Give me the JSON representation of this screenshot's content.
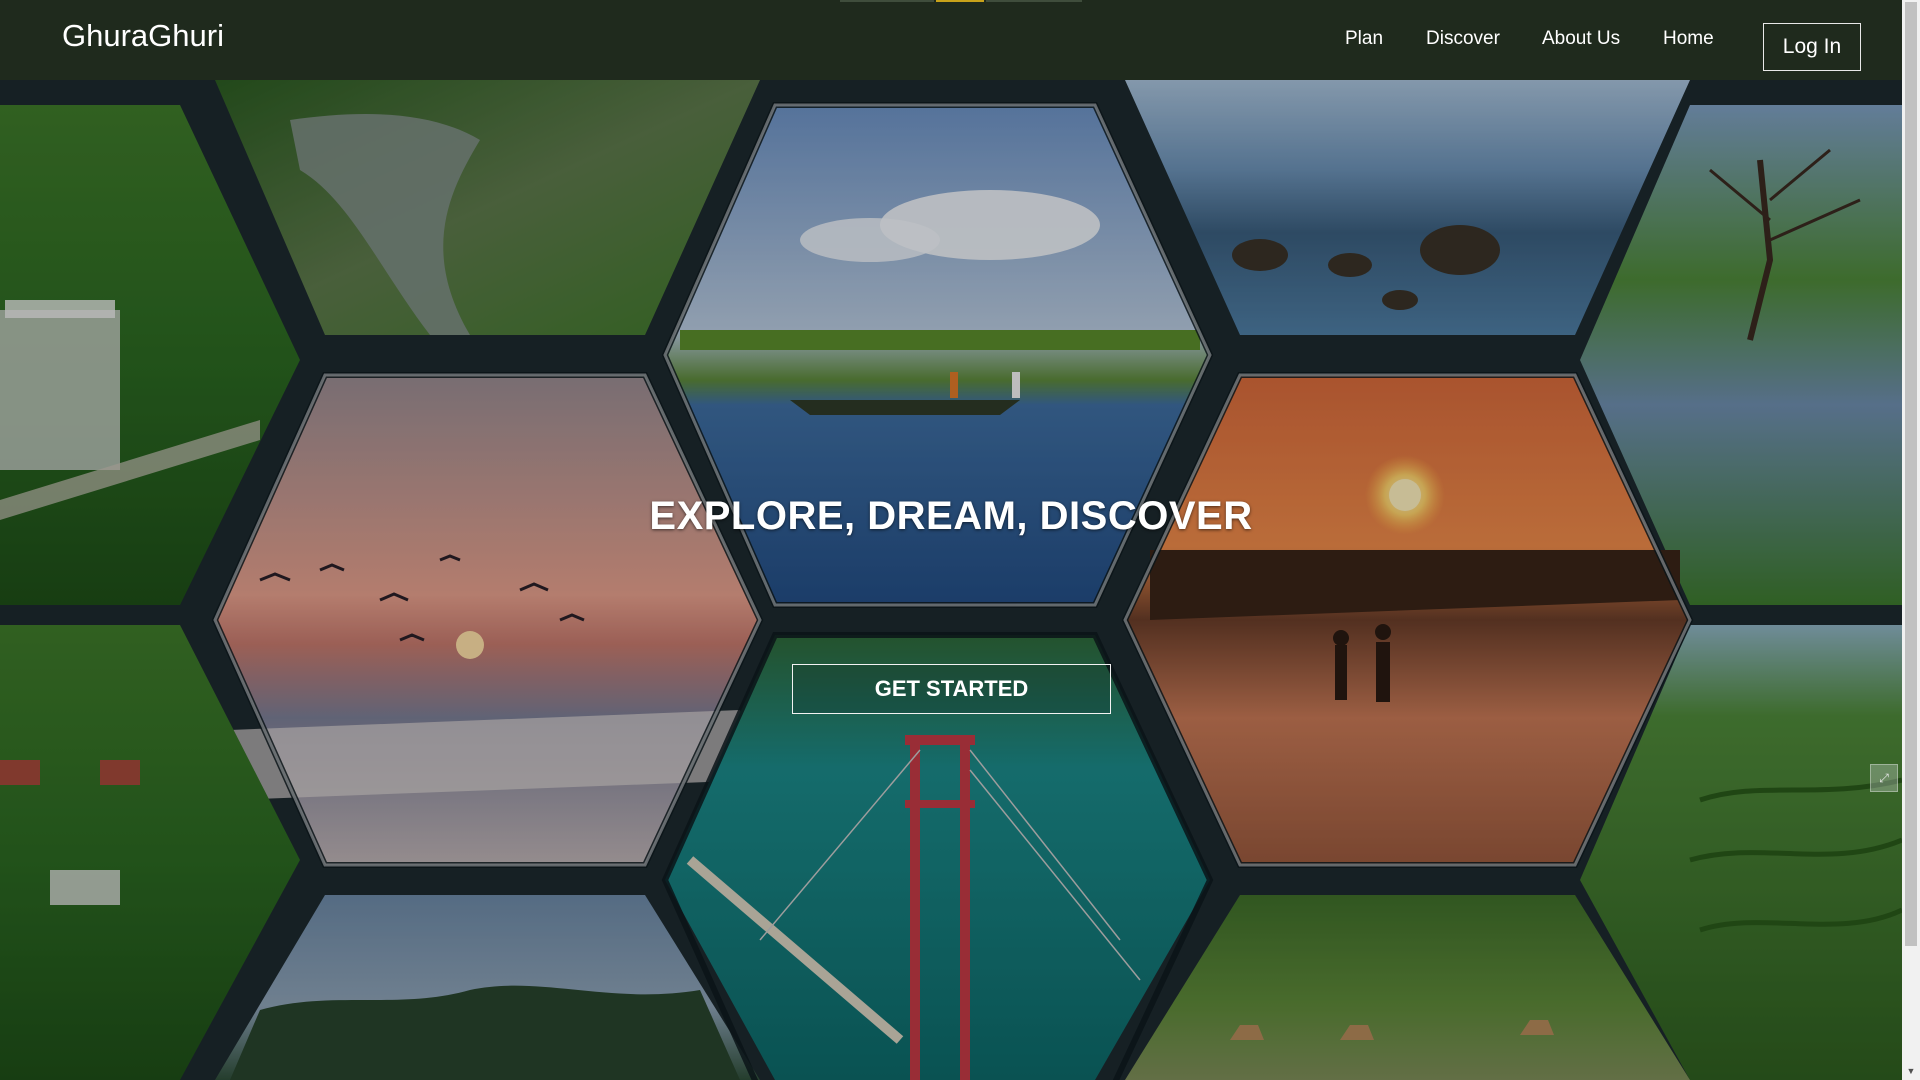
{
  "header": {
    "brand": "GhuraGhuri",
    "nav": [
      "Plan",
      "Discover",
      "About Us",
      "Home"
    ],
    "login_label": "Log In"
  },
  "hero": {
    "headline": "EXPLORE, DREAM, DISCOVER",
    "cta_label": "GET STARTED",
    "photos": [
      "tea-garden-hill-resort",
      "river-valley",
      "boat-on-lake",
      "rocky-seashore",
      "hillside-lake-tree",
      "beach-sunset-birds",
      "couple-sunset-beach",
      "hanging-bridge-lake",
      "hill-cottages",
      "tea-terraces",
      "misty-hills",
      "deer-in-forest"
    ]
  },
  "colors": {
    "navbar_bg": "#1f2a1d",
    "hex_frame": "#1d2a2f",
    "indicator_active": "#c8a21a",
    "indicator_inactive": "#3f4d3c"
  },
  "icons": {
    "side_arrow": "expand-arrows-icon",
    "scroll_down": "chevron-down-icon"
  }
}
